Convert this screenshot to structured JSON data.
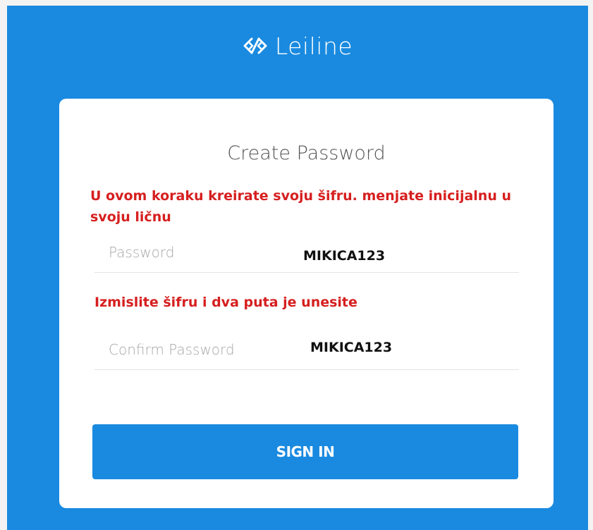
{
  "brand": {
    "name": "Leiline",
    "logo_icon": "diamond-link-logo-icon"
  },
  "colors": {
    "brand_blue": "#1a8ae0",
    "note_red": "#d61f1f",
    "card_background": "#ffffff"
  },
  "form": {
    "title": "Create Password",
    "instruction_note": "U ovom koraku kreirate svoju šifru. menjate inicijalnu u svoju ličnu",
    "secondary_note": "Izmislite šifru i dva puta je unesite",
    "password": {
      "label": "Password",
      "value": "MIKICA123"
    },
    "confirm_password": {
      "label": "Confirm Password",
      "value": "MIKICA123"
    },
    "submit_label": "SIGN IN"
  }
}
